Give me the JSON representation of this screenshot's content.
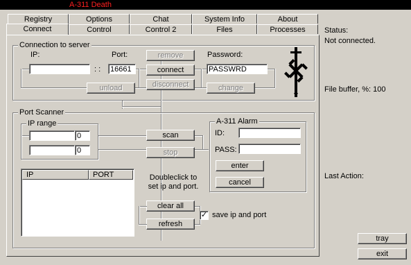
{
  "window": {
    "title": "A-311 Death"
  },
  "tabs_row1": [
    "Registry",
    "Options",
    "Chat",
    "System Info",
    "About"
  ],
  "tabs_row2": [
    "Connect",
    "Control",
    "Control 2",
    "Files",
    "Processes"
  ],
  "connection": {
    "group_label": "Connection to server",
    "ip_label": "IP:",
    "ip_value": "",
    "port_label": "Port:",
    "port_value": "16661",
    "separator": ": :",
    "password_label": "Password:",
    "password_value": "PASSWRD",
    "remove_button": "remove",
    "connect_button": "connect",
    "unload_button": "unload",
    "disconnect_button": "disconnect",
    "change_button": "change"
  },
  "scanner": {
    "group_label": "Port Scanner",
    "ip_range_label": "IP range",
    "range_start_value": "0",
    "range_end_value": "0",
    "scan_button": "scan",
    "stop_button": "stop",
    "columns": [
      "IP",
      "PORT"
    ],
    "hint": "Doubleclick to set ip and port.",
    "clear_button": "clear all",
    "refresh_button": "refresh",
    "save_label": "save ip and port",
    "save_checked": true
  },
  "alarm": {
    "group_label": "A-311 Alarm",
    "id_label": "ID:",
    "id_value": "",
    "pass_label": "PASS:",
    "pass_value": "",
    "enter_button": "enter",
    "cancel_button": "cancel"
  },
  "status": {
    "label": "Status:",
    "value": "Not connected.",
    "buffer": "File buffer, %: 100",
    "last_action": "Last Action:"
  },
  "buttons": {
    "tray": "tray",
    "exit": "exit"
  },
  "colors": {
    "title_bg": "#000000",
    "title_text": "#ff2020",
    "face": "#d4d0c8"
  }
}
